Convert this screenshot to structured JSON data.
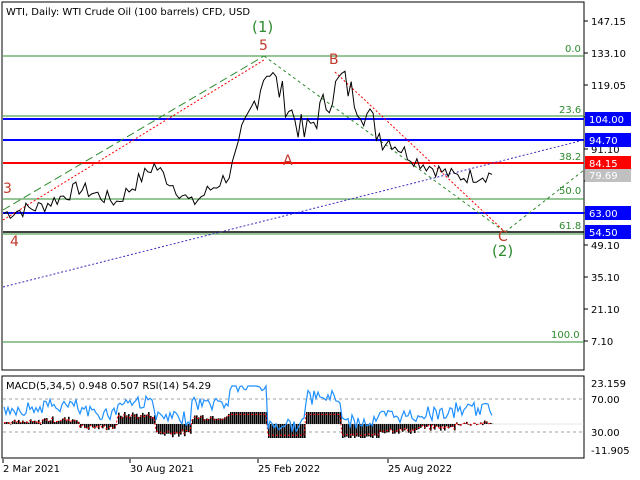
{
  "header": {
    "title": "WTI, Daily:  WTI Crude Oil (100 barrels) CFD, USD"
  },
  "colors": {
    "background": "#ffffff",
    "price": "#000000",
    "fib": "#2e8b2e",
    "support": "#0000ff",
    "resistance": "#ff0000",
    "macd_hist": "#000000",
    "macd_signal": "#ff0000",
    "rsi": "#1e90ff"
  },
  "price_axis": {
    "ticks": [
      "147.15",
      "133.10",
      "119.05",
      "105.00",
      "91.10",
      "77.05",
      "63.00",
      "49.10",
      "35.10",
      "21.10",
      "7.10"
    ]
  },
  "fib_levels": [
    {
      "label": "0.0",
      "value": 133.1
    },
    {
      "label": "23.6",
      "value": 104.6
    },
    {
      "label": "38.2",
      "value": 86.3
    },
    {
      "label": "50.0",
      "value": 72.3
    },
    {
      "label": "61.8",
      "value": 57.8
    },
    {
      "label": "100.0",
      "value": 12.3
    }
  ],
  "horizontal_levels": [
    {
      "label": "104.00",
      "value": 104.0,
      "kind": "support"
    },
    {
      "label": "94.70",
      "value": 94.7,
      "kind": "support"
    },
    {
      "label": "84.15",
      "value": 84.15,
      "kind": "resistance"
    },
    {
      "label": "63.00",
      "value": 63.0,
      "kind": "support"
    },
    {
      "label": "54.50",
      "value": 54.5,
      "kind": "support"
    }
  ],
  "current_price": "79.69",
  "wave_labels": [
    {
      "text": "(1)",
      "color": "#2e8b2e"
    },
    {
      "text": "5",
      "color": "#c0392b"
    },
    {
      "text": "B",
      "color": "#c0392b"
    },
    {
      "text": "A",
      "color": "#c0392b"
    },
    {
      "text": "3",
      "color": "#c0392b"
    },
    {
      "text": "4",
      "color": "#c0392b"
    },
    {
      "text": "C",
      "color": "#c0392b"
    },
    {
      "text": "(2)",
      "color": "#2e8b2e"
    }
  ],
  "indicator": {
    "label": "MACD(5,34,5) 0.948 0.507 RSI(14) 54.29",
    "ticks": [
      "23.159",
      "70.00",
      "30.00",
      "-11.905"
    ]
  },
  "time_axis": {
    "labels": [
      "2 Mar 2021",
      "30 Aug 2021",
      "25 Feb 2022",
      "25 Aug 2022"
    ]
  },
  "chart_data": {
    "type": "line",
    "title": "WTI, Daily:  WTI Crude Oil (100 barrels) CFD, USD",
    "x": [
      "2021-03",
      "2021-05",
      "2021-07",
      "2021-09",
      "2021-10",
      "2021-12",
      "2022-01",
      "2022-03",
      "2022-04",
      "2022-06",
      "2022-07",
      "2022-09",
      "2022-11",
      "2022-12"
    ],
    "series": [
      {
        "values": [
          63,
          66,
          74,
          68,
          84,
          67,
          80,
          127,
          97,
          122,
          98,
          86,
          79,
          80
        ]
      }
    ],
    "ylim": [
      0,
      155
    ]
  }
}
